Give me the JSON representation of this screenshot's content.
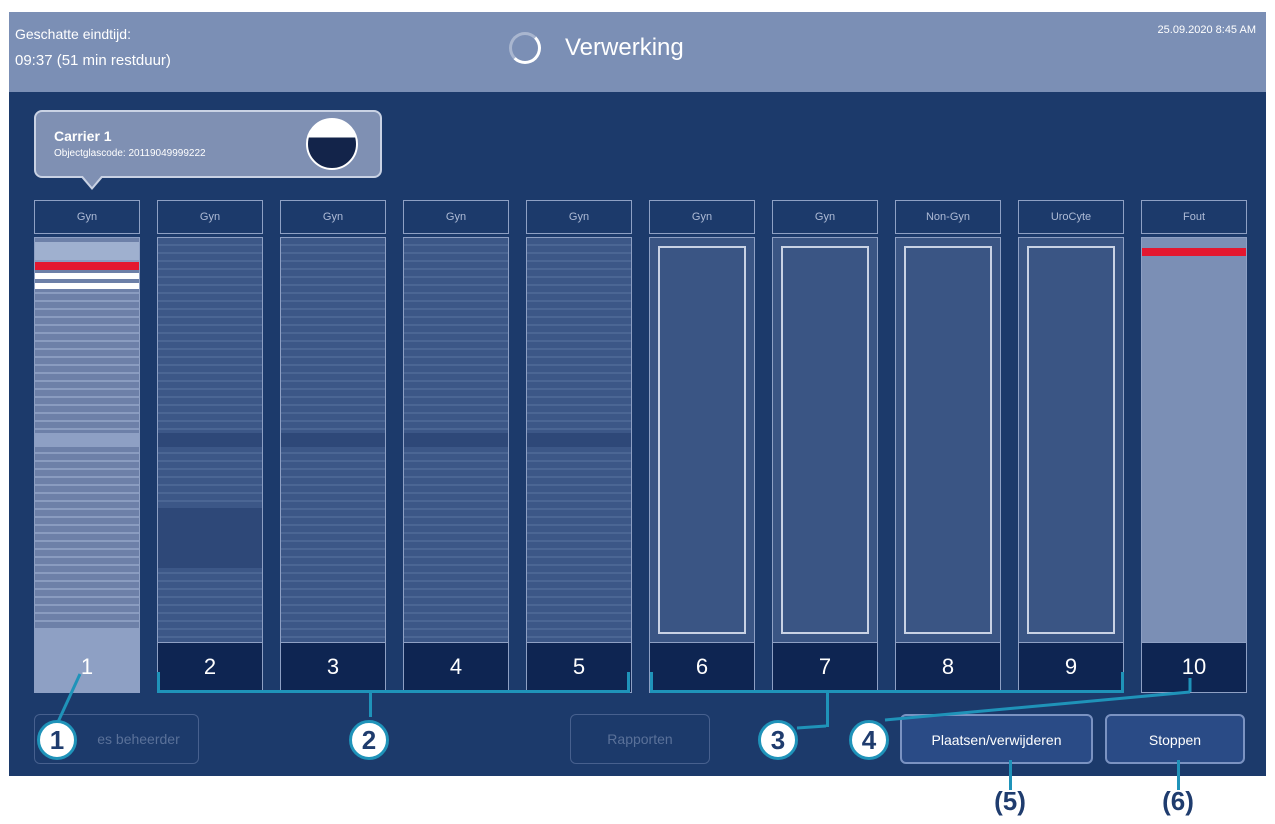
{
  "header": {
    "eta_label": "Geschatte eindtijd:",
    "eta_value": "09:37 (51 min restduur)",
    "title": "Verwerking",
    "datetime": "25.09.2020 8:45 AM",
    "spinner_icon": "spinner-icon"
  },
  "popover": {
    "title": "Carrier 1",
    "subtitle": "Objectglascode: 20119049999222",
    "fill_icon": "fill-level-icon"
  },
  "carriers": [
    {
      "number": "1",
      "label": "Gyn",
      "state": "filled-selected"
    },
    {
      "number": "2",
      "label": "Gyn",
      "state": "filled"
    },
    {
      "number": "3",
      "label": "Gyn",
      "state": "filled"
    },
    {
      "number": "4",
      "label": "Gyn",
      "state": "filled"
    },
    {
      "number": "5",
      "label": "Gyn",
      "state": "filled"
    },
    {
      "number": "6",
      "label": "Gyn",
      "state": "empty"
    },
    {
      "number": "7",
      "label": "Gyn",
      "state": "empty"
    },
    {
      "number": "8",
      "label": "Non-Gyn",
      "state": "empty"
    },
    {
      "number": "9",
      "label": "UroCyte",
      "state": "empty"
    },
    {
      "number": "10",
      "label": "Fout",
      "state": "error"
    }
  ],
  "buttons": {
    "admin": "Opties beheerder",
    "admin_visible": "es beheerder",
    "reports": "Rapporten",
    "place_remove": "Plaatsen/verwijderen",
    "stop": "Stoppen"
  },
  "callouts": [
    "1",
    "2",
    "3",
    "4",
    "(5)",
    "(6)"
  ],
  "colors": {
    "screen_bg": "#1c3a6b",
    "header_bg": "#7b8fb5",
    "callout": "#1f93b9",
    "error": "#e4172f"
  }
}
